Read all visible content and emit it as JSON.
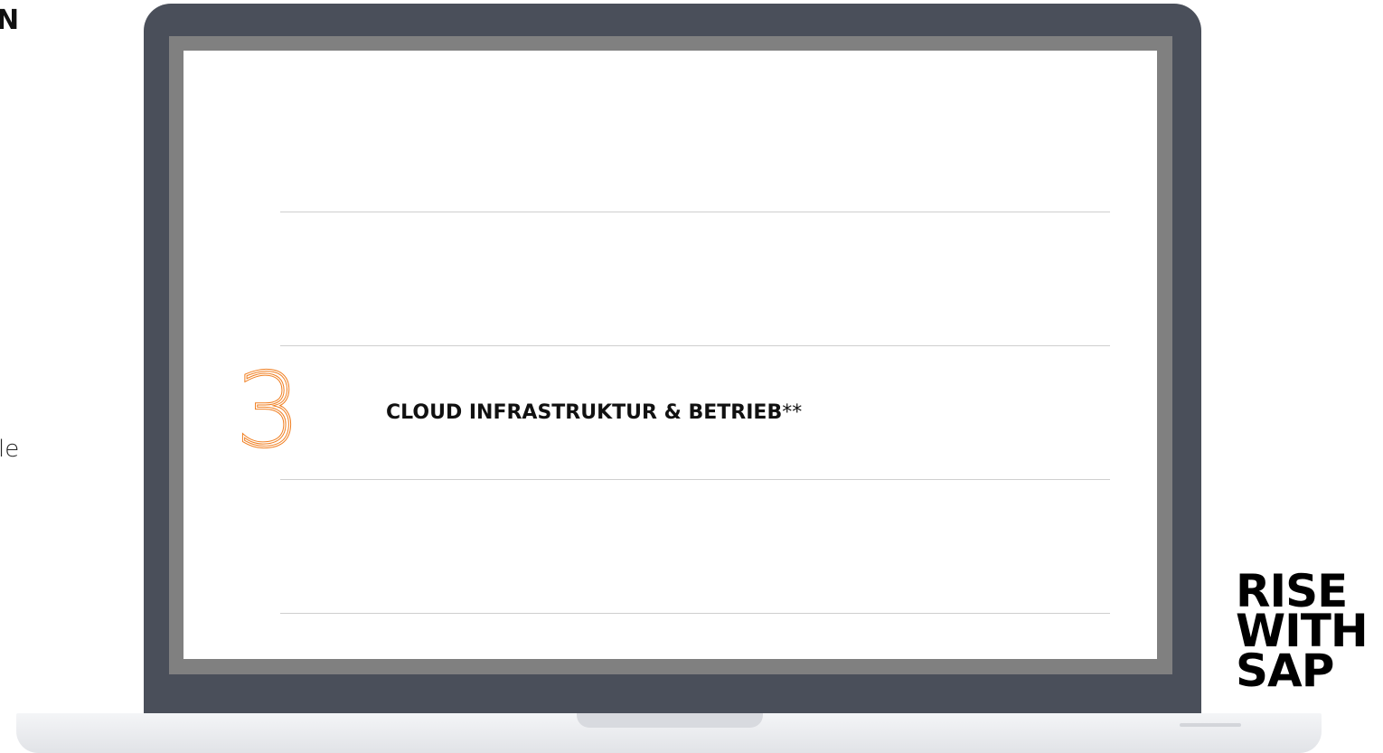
{
  "edge": {
    "heading": "N",
    "text": "le"
  },
  "screen": {
    "step": {
      "number": "3",
      "label": "CLOUD INFRASTRUKTUR & BETRIEB",
      "suffix": "**"
    }
  },
  "logo": {
    "lines": [
      "RISE",
      "WITH",
      "SAP"
    ]
  },
  "colors": {
    "accent": "#f07d1e",
    "device_body": "#4a4f5a",
    "screen_bezel": "#808080"
  }
}
